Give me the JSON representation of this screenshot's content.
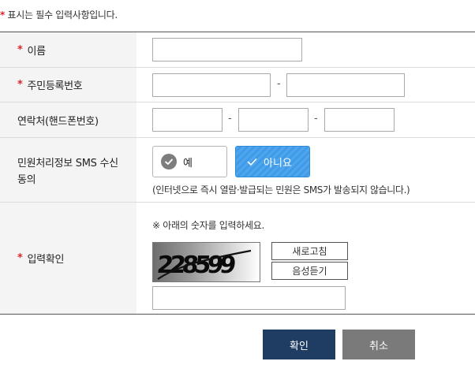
{
  "required_note": {
    "mark": "*",
    "text": "표시는 필수 입력사항입니다."
  },
  "fields": {
    "name": {
      "label": "이름",
      "required": true,
      "value": ""
    },
    "resident_number": {
      "label": "주민등록번호",
      "required": true,
      "separator": "-",
      "part1": "",
      "part2": ""
    },
    "contact": {
      "label": "연락처(핸드폰번호)",
      "required": false,
      "separator": "-",
      "part1": "",
      "part2": "",
      "part3": ""
    },
    "sms_consent": {
      "label_line1": "민원처리정보 SMS 수신",
      "label_line2": "동의",
      "options": [
        "예",
        "아니요"
      ],
      "selected": "아니요",
      "note": "(인터넷으로 즉시 열람·발급되는 민원은 SMS가 발송되지 않습니다.)"
    },
    "captcha": {
      "label": "입력확인",
      "required": true,
      "instruction": "※ 아래의 숫자를 입력하세요.",
      "image_text": "228599",
      "refresh_label": "새로고침",
      "audio_label": "음성듣기",
      "value": ""
    }
  },
  "actions": {
    "confirm_label": "확인",
    "cancel_label": "취소"
  },
  "colors": {
    "required_mark": "#d9262b",
    "label_bg": "#f4f4f4",
    "selected_option": "#3d9be9",
    "confirm_button": "#1f3d63",
    "cancel_button": "#7a7a7a"
  },
  "icons": {
    "yes_option": "check-circle-icon",
    "no_option": "check-icon"
  }
}
